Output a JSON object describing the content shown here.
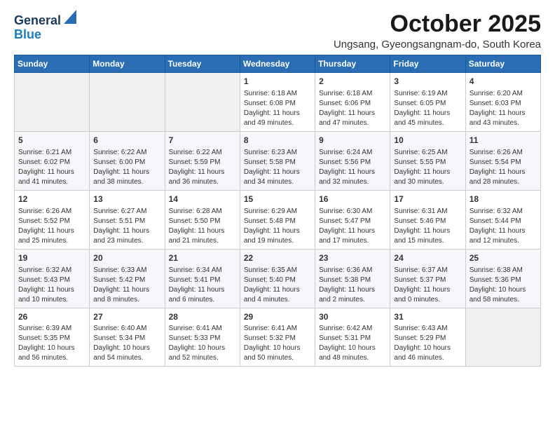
{
  "logo": {
    "line1": "General",
    "line2": "Blue"
  },
  "header": {
    "month": "October 2025",
    "location": "Ungsang, Gyeongsangnam-do, South Korea"
  },
  "days_of_week": [
    "Sunday",
    "Monday",
    "Tuesday",
    "Wednesday",
    "Thursday",
    "Friday",
    "Saturday"
  ],
  "weeks": [
    [
      {
        "day": "",
        "content": ""
      },
      {
        "day": "",
        "content": ""
      },
      {
        "day": "",
        "content": ""
      },
      {
        "day": "1",
        "content": "Sunrise: 6:18 AM\nSunset: 6:08 PM\nDaylight: 11 hours\nand 49 minutes."
      },
      {
        "day": "2",
        "content": "Sunrise: 6:18 AM\nSunset: 6:06 PM\nDaylight: 11 hours\nand 47 minutes."
      },
      {
        "day": "3",
        "content": "Sunrise: 6:19 AM\nSunset: 6:05 PM\nDaylight: 11 hours\nand 45 minutes."
      },
      {
        "day": "4",
        "content": "Sunrise: 6:20 AM\nSunset: 6:03 PM\nDaylight: 11 hours\nand 43 minutes."
      }
    ],
    [
      {
        "day": "5",
        "content": "Sunrise: 6:21 AM\nSunset: 6:02 PM\nDaylight: 11 hours\nand 41 minutes."
      },
      {
        "day": "6",
        "content": "Sunrise: 6:22 AM\nSunset: 6:00 PM\nDaylight: 11 hours\nand 38 minutes."
      },
      {
        "day": "7",
        "content": "Sunrise: 6:22 AM\nSunset: 5:59 PM\nDaylight: 11 hours\nand 36 minutes."
      },
      {
        "day": "8",
        "content": "Sunrise: 6:23 AM\nSunset: 5:58 PM\nDaylight: 11 hours\nand 34 minutes."
      },
      {
        "day": "9",
        "content": "Sunrise: 6:24 AM\nSunset: 5:56 PM\nDaylight: 11 hours\nand 32 minutes."
      },
      {
        "day": "10",
        "content": "Sunrise: 6:25 AM\nSunset: 5:55 PM\nDaylight: 11 hours\nand 30 minutes."
      },
      {
        "day": "11",
        "content": "Sunrise: 6:26 AM\nSunset: 5:54 PM\nDaylight: 11 hours\nand 28 minutes."
      }
    ],
    [
      {
        "day": "12",
        "content": "Sunrise: 6:26 AM\nSunset: 5:52 PM\nDaylight: 11 hours\nand 25 minutes."
      },
      {
        "day": "13",
        "content": "Sunrise: 6:27 AM\nSunset: 5:51 PM\nDaylight: 11 hours\nand 23 minutes."
      },
      {
        "day": "14",
        "content": "Sunrise: 6:28 AM\nSunset: 5:50 PM\nDaylight: 11 hours\nand 21 minutes."
      },
      {
        "day": "15",
        "content": "Sunrise: 6:29 AM\nSunset: 5:48 PM\nDaylight: 11 hours\nand 19 minutes."
      },
      {
        "day": "16",
        "content": "Sunrise: 6:30 AM\nSunset: 5:47 PM\nDaylight: 11 hours\nand 17 minutes."
      },
      {
        "day": "17",
        "content": "Sunrise: 6:31 AM\nSunset: 5:46 PM\nDaylight: 11 hours\nand 15 minutes."
      },
      {
        "day": "18",
        "content": "Sunrise: 6:32 AM\nSunset: 5:44 PM\nDaylight: 11 hours\nand 12 minutes."
      }
    ],
    [
      {
        "day": "19",
        "content": "Sunrise: 6:32 AM\nSunset: 5:43 PM\nDaylight: 11 hours\nand 10 minutes."
      },
      {
        "day": "20",
        "content": "Sunrise: 6:33 AM\nSunset: 5:42 PM\nDaylight: 11 hours\nand 8 minutes."
      },
      {
        "day": "21",
        "content": "Sunrise: 6:34 AM\nSunset: 5:41 PM\nDaylight: 11 hours\nand 6 minutes."
      },
      {
        "day": "22",
        "content": "Sunrise: 6:35 AM\nSunset: 5:40 PM\nDaylight: 11 hours\nand 4 minutes."
      },
      {
        "day": "23",
        "content": "Sunrise: 6:36 AM\nSunset: 5:38 PM\nDaylight: 11 hours\nand 2 minutes."
      },
      {
        "day": "24",
        "content": "Sunrise: 6:37 AM\nSunset: 5:37 PM\nDaylight: 11 hours\nand 0 minutes."
      },
      {
        "day": "25",
        "content": "Sunrise: 6:38 AM\nSunset: 5:36 PM\nDaylight: 10 hours\nand 58 minutes."
      }
    ],
    [
      {
        "day": "26",
        "content": "Sunrise: 6:39 AM\nSunset: 5:35 PM\nDaylight: 10 hours\nand 56 minutes."
      },
      {
        "day": "27",
        "content": "Sunrise: 6:40 AM\nSunset: 5:34 PM\nDaylight: 10 hours\nand 54 minutes."
      },
      {
        "day": "28",
        "content": "Sunrise: 6:41 AM\nSunset: 5:33 PM\nDaylight: 10 hours\nand 52 minutes."
      },
      {
        "day": "29",
        "content": "Sunrise: 6:41 AM\nSunset: 5:32 PM\nDaylight: 10 hours\nand 50 minutes."
      },
      {
        "day": "30",
        "content": "Sunrise: 6:42 AM\nSunset: 5:31 PM\nDaylight: 10 hours\nand 48 minutes."
      },
      {
        "day": "31",
        "content": "Sunrise: 6:43 AM\nSunset: 5:29 PM\nDaylight: 10 hours\nand 46 minutes."
      },
      {
        "day": "",
        "content": ""
      }
    ]
  ]
}
